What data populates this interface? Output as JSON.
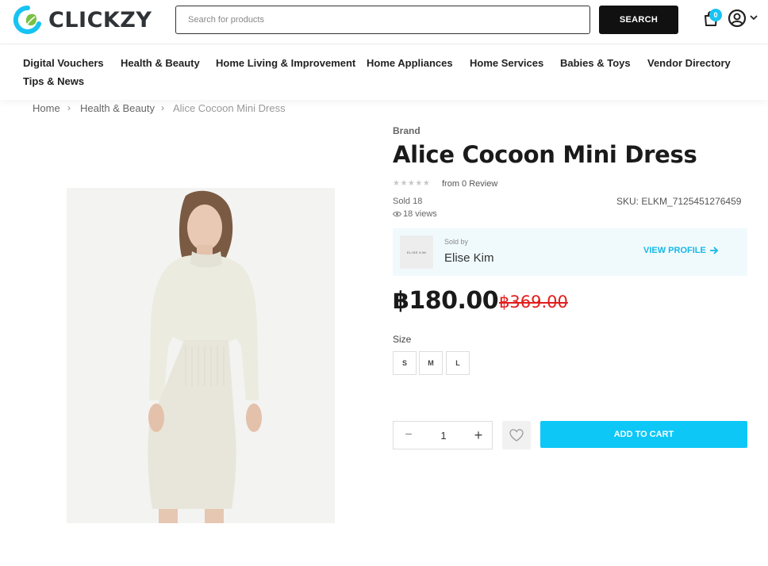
{
  "brand": {
    "name": "CLICKZY",
    "accent_color": "#17c3f2",
    "leaf_color": "#79c143"
  },
  "header": {
    "search_placeholder": "Search for products",
    "search_button": "SEARCH",
    "cart_count": "0",
    "icons": [
      "cart-icon",
      "account-icon",
      "chevron-down-icon"
    ]
  },
  "nav": {
    "items": [
      {
        "label": "Digital Vouchers"
      },
      {
        "label": "Health & Beauty"
      },
      {
        "label": "Home Living & Improvement"
      },
      {
        "label": "Home Appliances"
      },
      {
        "label": "Home Services"
      },
      {
        "label": "Babies & Toys"
      },
      {
        "label": "Vendor Directory"
      },
      {
        "label": "Tips & News"
      }
    ]
  },
  "breadcrumb": {
    "items": [
      "Home",
      "Health & Beauty",
      "Alice Cocoon Mini Dress"
    ]
  },
  "product": {
    "brand_label": "Brand",
    "title": "Alice Cocoon Mini Dress",
    "rating_stars": 0,
    "review_text": "from  0  Review",
    "sold": "Sold 18",
    "views": "18 views",
    "sku": "SKU:  ELKM_7125451276459",
    "seller": {
      "sold_by_label": "Sold by",
      "name": "Elise Kim",
      "logo_text": "ELISE KIM",
      "view_profile": "VIEW PROFILE"
    },
    "price": "฿180.00",
    "old_price": "฿369.00",
    "size_label": "Size",
    "sizes": [
      "S",
      "M",
      "L"
    ],
    "quantity": "1",
    "add_to_cart": "ADD TO CART",
    "old_price_color": "#e21d1d",
    "cta_color": "#0dc7f7"
  }
}
